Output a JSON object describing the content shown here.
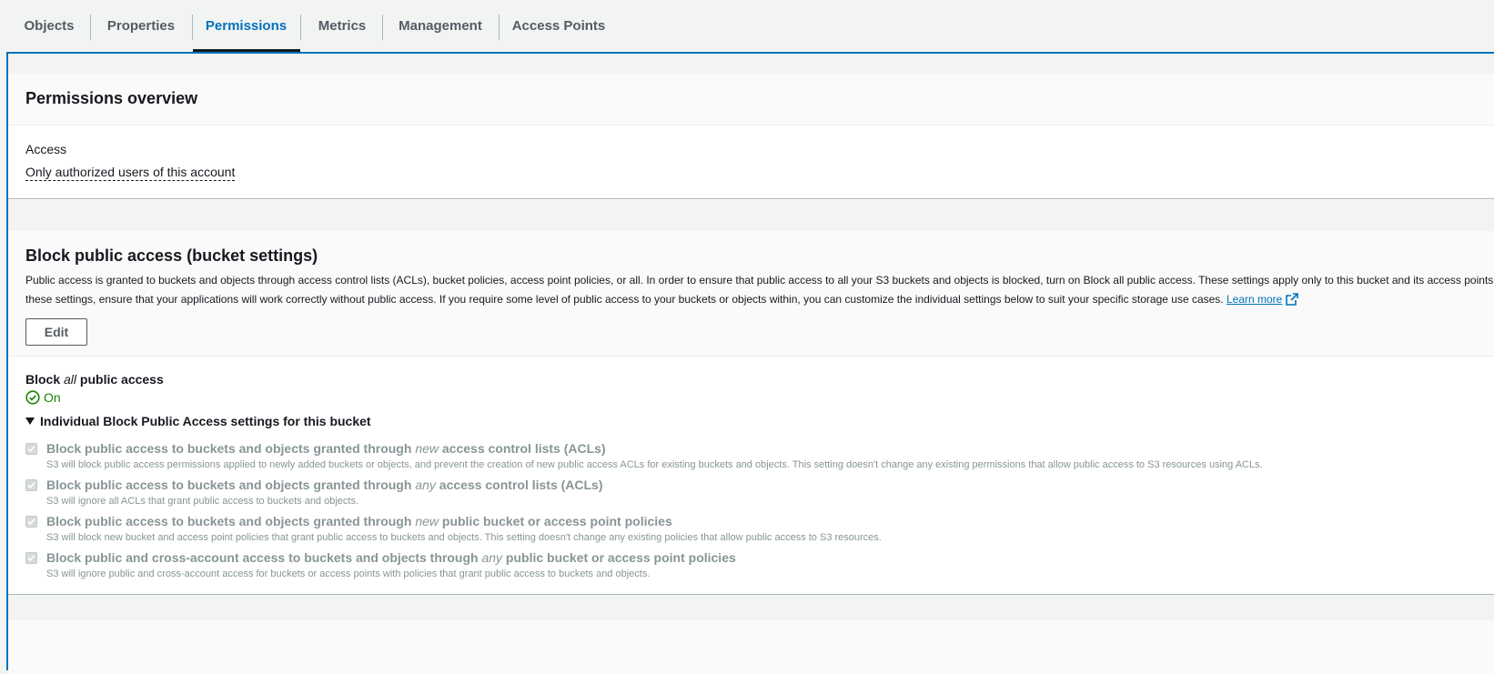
{
  "tabs": [
    {
      "label": "Objects"
    },
    {
      "label": "Properties"
    },
    {
      "label": "Permissions",
      "active": true
    },
    {
      "label": "Metrics"
    },
    {
      "label": "Management"
    },
    {
      "label": "Access Points"
    }
  ],
  "overview": {
    "title": "Permissions overview",
    "access_label": "Access",
    "access_value": "Only authorized users of this account"
  },
  "bpa": {
    "title": "Block public access (bucket settings)",
    "desc_line1": "Public access is granted to buckets and objects through access control lists (ACLs), bucket policies, access point policies, or all. In order to ensure that public access to all your S3 buckets and objects is blocked, turn on Block all public access. These settings apply only to this bucket and its access points",
    "desc_line2": "these settings, ensure that your applications will work correctly without public access. If you require some level of public access to your buckets or objects within, you can customize the individual settings below to suit your specific storage use cases.",
    "learn_more": "Learn more",
    "edit_label": "Edit",
    "block_all_pre": "Block",
    "block_all_em": "all",
    "block_all_post": "public access",
    "status": "On",
    "expander_label": "Individual Block Public Access settings for this bucket",
    "settings": [
      {
        "title_pre": "Block public access to buckets and objects granted through",
        "title_em": "new",
        "title_post": "access control lists (ACLs)",
        "desc": "S3 will block public access permissions applied to newly added buckets or objects, and prevent the creation of new public access ACLs for existing buckets and objects. This setting doesn't change any existing permissions that allow public access to S3 resources using ACLs.",
        "checked": true
      },
      {
        "title_pre": "Block public access to buckets and objects granted through",
        "title_em": "any",
        "title_post": "access control lists (ACLs)",
        "desc": "S3 will ignore all ACLs that grant public access to buckets and objects.",
        "checked": true
      },
      {
        "title_pre": "Block public access to buckets and objects granted through",
        "title_em": "new",
        "title_post": "public bucket or access point policies",
        "desc": "S3 will block new bucket and access point policies that grant public access to buckets and objects. This setting doesn't change any existing policies that allow public access to S3 resources.",
        "checked": true
      },
      {
        "title_pre": "Block public and cross-account access to buckets and objects through",
        "title_em": "any",
        "title_post": "public bucket or access point policies",
        "desc": "S3 will ignore public and cross-account access for buckets or access points with policies that grant public access to buckets and objects.",
        "checked": true
      }
    ]
  },
  "colors": {
    "accent": "#0073bb",
    "success": "#1d8102",
    "disabled_text": "#879596"
  },
  "icons": [
    "check-circle-icon",
    "external-link-icon",
    "caret-down-icon",
    "checkbox-checked-icon"
  ]
}
